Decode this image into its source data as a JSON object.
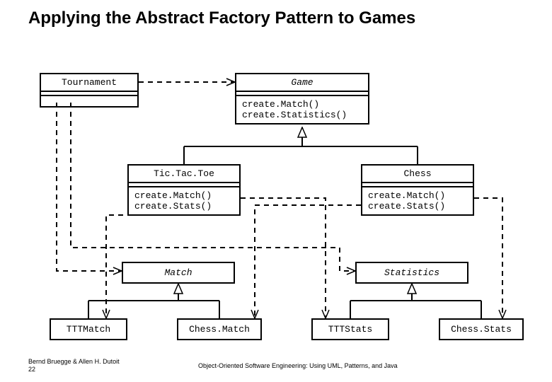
{
  "title": "Applying the Abstract Factory Pattern to Games",
  "footer": {
    "credits_line1": "Bernd Bruegge & Allen H. Dutoit",
    "credits_line2": "22",
    "book": "Object-Oriented Software Engineering: Using UML, Patterns, and Java"
  },
  "classes": {
    "tournament": {
      "name": "Tournament"
    },
    "game": {
      "name": "Game",
      "ops": "create.Match()\ncreate.Statistics()"
    },
    "tictactoe": {
      "name": "Tic.Tac.Toe",
      "ops": "create.Match()\ncreate.Stats()"
    },
    "chess": {
      "name": "Chess",
      "ops": "create.Match()\ncreate.Stats()"
    },
    "match": {
      "name": "Match"
    },
    "statistics": {
      "name": "Statistics"
    },
    "tttmatch": {
      "name": "TTTMatch"
    },
    "chessmatch": {
      "name": "Chess.Match"
    },
    "tttstats": {
      "name": "TTTStats"
    },
    "chessstats": {
      "name": "Chess.Stats"
    }
  },
  "chart_data": {
    "type": "diagram",
    "pattern": "Abstract Factory (UML class diagram)",
    "abstract_classes": [
      "Game",
      "Match",
      "Statistics"
    ],
    "concrete_factories": [
      "Tic.Tac.Toe",
      "Chess"
    ],
    "concrete_products": {
      "Match": [
        "TTTMatch",
        "Chess.Match"
      ],
      "Statistics": [
        "TTTStats",
        "Chess.Stats"
      ]
    },
    "client": "Tournament",
    "operations": {
      "Game": [
        "create.Match()",
        "create.Statistics()"
      ],
      "Tic.Tac.Toe": [
        "create.Match()",
        "create.Stats()"
      ],
      "Chess": [
        "create.Match()",
        "create.Stats()"
      ]
    },
    "relationships": [
      {
        "from": "Tournament",
        "to": "Game",
        "kind": "dependency"
      },
      {
        "from": "Tournament",
        "to": "Match",
        "kind": "dependency"
      },
      {
        "from": "Tournament",
        "to": "Statistics",
        "kind": "dependency"
      },
      {
        "from": "Tic.Tac.Toe",
        "to": "Game",
        "kind": "generalization"
      },
      {
        "from": "Chess",
        "to": "Game",
        "kind": "generalization"
      },
      {
        "from": "TTTMatch",
        "to": "Match",
        "kind": "generalization"
      },
      {
        "from": "Chess.Match",
        "to": "Match",
        "kind": "generalization"
      },
      {
        "from": "TTTStats",
        "to": "Statistics",
        "kind": "generalization"
      },
      {
        "from": "Chess.Stats",
        "to": "Statistics",
        "kind": "generalization"
      },
      {
        "from": "Tic.Tac.Toe",
        "to": "TTTMatch",
        "kind": "create-dependency"
      },
      {
        "from": "Tic.Tac.Toe",
        "to": "TTTStats",
        "kind": "create-dependency"
      },
      {
        "from": "Chess",
        "to": "Chess.Match",
        "kind": "create-dependency"
      },
      {
        "from": "Chess",
        "to": "Chess.Stats",
        "kind": "create-dependency"
      }
    ]
  }
}
